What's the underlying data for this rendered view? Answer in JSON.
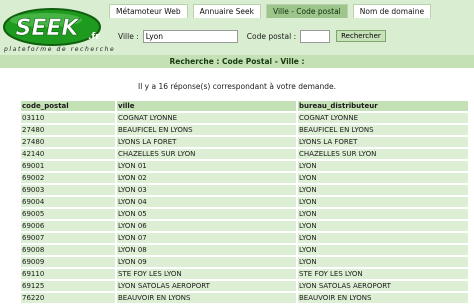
{
  "logo": {
    "text": "SEEK",
    "suffix": ".fr",
    "tagline": "plateforme de recherche",
    "accent": "#1e9a1e"
  },
  "tabs": [
    {
      "label": "Métamoteur Web",
      "active": false
    },
    {
      "label": "Annuaire Seek",
      "active": false
    },
    {
      "label": "Ville - Code postal",
      "active": true
    },
    {
      "label": "Nom de domaine",
      "active": false
    }
  ],
  "search": {
    "city_label": "Ville :",
    "city_value": "Lyon",
    "zip_label": "Code postal :",
    "zip_value": "",
    "button_label": "Rechercher"
  },
  "subtitle": "Recherche : Code Postal - Ville :",
  "result_count": "Il y a 16 réponse(s) correspondant à votre demande.",
  "table": {
    "headers": [
      "code_postal",
      "ville",
      "bureau_distributeur"
    ],
    "rows": [
      [
        "03110",
        "COGNAT LYONNE",
        "COGNAT LYONNE"
      ],
      [
        "27480",
        "BEAUFICEL EN LYONS",
        "BEAUFICEL EN LYONS"
      ],
      [
        "27480",
        "LYONS LA FORET",
        "LYONS LA FORET"
      ],
      [
        "42140",
        "CHAZELLES SUR LYON",
        "CHAZELLES SUR LYON"
      ],
      [
        "69001",
        "LYON 01",
        "LYON"
      ],
      [
        "69002",
        "LYON 02",
        "LYON"
      ],
      [
        "69003",
        "LYON 03",
        "LYON"
      ],
      [
        "69004",
        "LYON 04",
        "LYON"
      ],
      [
        "69005",
        "LYON 05",
        "LYON"
      ],
      [
        "69006",
        "LYON 06",
        "LYON"
      ],
      [
        "69007",
        "LYON 07",
        "LYON"
      ],
      [
        "69008",
        "LYON 08",
        "LYON"
      ],
      [
        "69009",
        "LYON 09",
        "LYON"
      ],
      [
        "69110",
        "STE FOY LES LYON",
        "STE FOY LES LYON"
      ],
      [
        "69125",
        "LYON SATOLAS AEROPORT",
        "LYON SATOLAS AEROPORT"
      ],
      [
        "76220",
        "BEAUVOIR EN LYONS",
        "BEAUVOIR EN LYONS"
      ]
    ]
  }
}
